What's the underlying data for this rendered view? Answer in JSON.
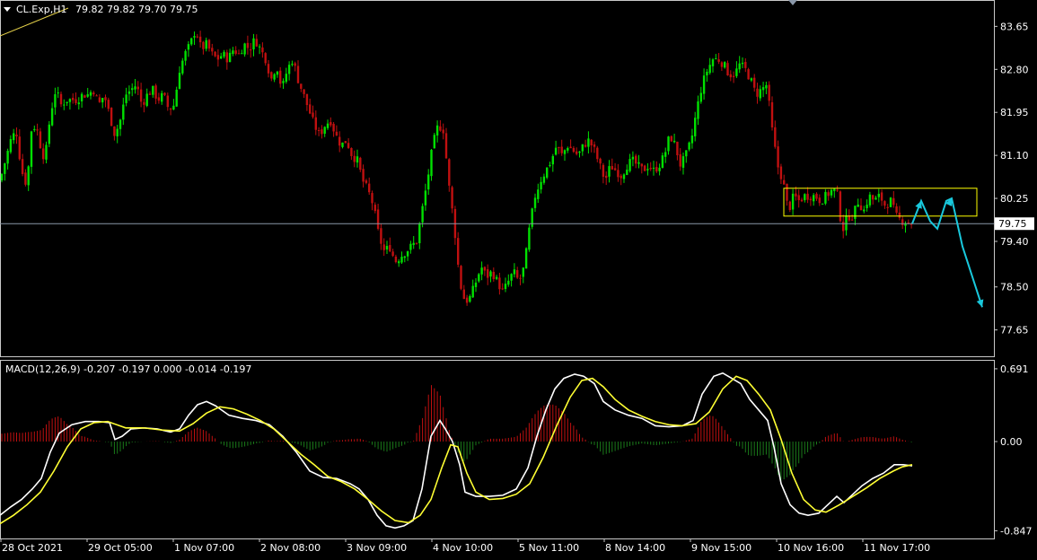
{
  "header": {
    "symbol_text": "CL.Exp,H1",
    "ohlc_text": "79.82 79.82 79.70 79.75"
  },
  "macd_header": "MACD(12,26,9) -0.207 -0.197 0.000 -0.014 -0.197",
  "colors": {
    "background": "#000000",
    "bull": "#00e000",
    "bear": "#c01010",
    "hist_pos": "#c01010",
    "hist_neg": "#1a7a1a",
    "macd_line": "#ffffff",
    "signal_line": "#ffff33",
    "arrow": "#19c8dc",
    "consolidation_box": "#ffff00",
    "price_line": "#8a97a8",
    "frame": "#c8c8c8"
  },
  "chart_data": [
    {
      "type": "candlestick",
      "title": "CL.Exp,H1",
      "ylim": [
        77.2,
        84.1
      ],
      "y_ticks": [
        "83.65",
        "82.80",
        "81.95",
        "81.10",
        "80.25",
        "79.40",
        "78.50",
        "77.65"
      ],
      "current_price": "79.75",
      "x_ticks": [
        "28 Oct 2021",
        "29 Oct 05:00",
        "1 Nov 07:00",
        "2 Nov 08:00",
        "3 Nov 09:00",
        "4 Nov 10:00",
        "5 Nov 11:00",
        "8 Nov 14:00",
        "9 Nov 15:00",
        "10 Nov 16:00",
        "11 Nov 17:00"
      ],
      "close_path": [
        [
          0,
          80.6
        ],
        [
          6,
          81.0
        ],
        [
          12,
          81.4
        ],
        [
          18,
          81.6
        ],
        [
          24,
          80.8
        ],
        [
          30,
          80.5
        ],
        [
          35,
          81.6
        ],
        [
          40,
          81.7
        ],
        [
          45,
          81.3
        ],
        [
          50,
          81.0
        ],
        [
          56,
          81.9
        ],
        [
          62,
          82.4
        ],
        [
          68,
          82.1
        ],
        [
          74,
          82.2
        ],
        [
          80,
          82.2
        ],
        [
          86,
          82.2
        ],
        [
          92,
          82.3
        ],
        [
          98,
          82.3
        ],
        [
          104,
          82.4
        ],
        [
          110,
          82.1
        ],
        [
          116,
          82.3
        ],
        [
          122,
          81.9
        ],
        [
          128,
          81.5
        ],
        [
          134,
          81.8
        ],
        [
          140,
          82.3
        ],
        [
          146,
          82.4
        ],
        [
          152,
          82.5
        ],
        [
          158,
          82.1
        ],
        [
          164,
          82.3
        ],
        [
          170,
          82.4
        ],
        [
          176,
          82.2
        ],
        [
          182,
          82.3
        ],
        [
          188,
          82.0
        ],
        [
          194,
          82.1
        ],
        [
          200,
          82.8
        ],
        [
          206,
          83.1
        ],
        [
          212,
          83.3
        ],
        [
          218,
          83.6
        ],
        [
          224,
          83.2
        ],
        [
          230,
          83.3
        ],
        [
          236,
          83.1
        ],
        [
          242,
          83.0
        ],
        [
          248,
          83.1
        ],
        [
          254,
          83.0
        ],
        [
          260,
          83.2
        ],
        [
          266,
          83.1
        ],
        [
          272,
          83.3
        ],
        [
          278,
          83.2
        ],
        [
          284,
          83.4
        ],
        [
          290,
          83.2
        ],
        [
          296,
          83.0
        ],
        [
          302,
          82.6
        ],
        [
          308,
          82.9
        ],
        [
          314,
          82.4
        ],
        [
          320,
          82.8
        ],
        [
          326,
          83.0
        ],
        [
          332,
          82.6
        ],
        [
          338,
          82.3
        ],
        [
          344,
          82.0
        ],
        [
          350,
          81.7
        ],
        [
          356,
          81.5
        ],
        [
          362,
          81.7
        ],
        [
          368,
          81.8
        ],
        [
          374,
          81.5
        ],
        [
          380,
          81.3
        ],
        [
          386,
          81.4
        ],
        [
          392,
          81.1
        ],
        [
          398,
          81.0
        ],
        [
          404,
          80.6
        ],
        [
          410,
          80.4
        ],
        [
          416,
          80.1
        ],
        [
          422,
          79.5
        ],
        [
          428,
          79.2
        ],
        [
          434,
          79.3
        ],
        [
          440,
          79.0
        ],
        [
          446,
          79.1
        ],
        [
          452,
          79.2
        ],
        [
          458,
          79.3
        ],
        [
          464,
          79.4
        ],
        [
          470,
          80.0
        ],
        [
          476,
          80.6
        ],
        [
          482,
          81.3
        ],
        [
          488,
          81.7
        ],
        [
          494,
          81.6
        ],
        [
          500,
          80.5
        ],
        [
          506,
          79.7
        ],
        [
          512,
          78.6
        ],
        [
          518,
          78.2
        ],
        [
          524,
          78.3
        ],
        [
          530,
          78.6
        ],
        [
          536,
          78.9
        ],
        [
          542,
          78.7
        ],
        [
          548,
          78.8
        ],
        [
          554,
          78.6
        ],
        [
          560,
          78.4
        ],
        [
          566,
          78.6
        ],
        [
          572,
          78.8
        ],
        [
          578,
          78.6
        ],
        [
          584,
          78.9
        ],
        [
          590,
          79.7
        ],
        [
          596,
          80.3
        ],
        [
          602,
          80.6
        ],
        [
          608,
          80.8
        ],
        [
          614,
          81.0
        ],
        [
          620,
          81.3
        ],
        [
          626,
          81.1
        ],
        [
          632,
          81.3
        ],
        [
          638,
          81.2
        ],
        [
          644,
          81.1
        ],
        [
          650,
          81.3
        ],
        [
          656,
          81.4
        ],
        [
          662,
          81.2
        ],
        [
          668,
          80.9
        ],
        [
          674,
          80.6
        ],
        [
          680,
          80.9
        ],
        [
          686,
          80.8
        ],
        [
          692,
          80.7
        ],
        [
          698,
          80.9
        ],
        [
          704,
          81.0
        ],
        [
          710,
          80.9
        ],
        [
          716,
          80.8
        ],
        [
          722,
          80.9
        ],
        [
          728,
          80.8
        ],
        [
          734,
          80.9
        ],
        [
          740,
          81.1
        ],
        [
          746,
          81.5
        ],
        [
          752,
          81.3
        ],
        [
          758,
          80.9
        ],
        [
          764,
          81.1
        ],
        [
          770,
          81.4
        ],
        [
          776,
          82.0
        ],
        [
          782,
          82.5
        ],
        [
          788,
          82.8
        ],
        [
          794,
          83.0
        ],
        [
          800,
          83.0
        ],
        [
          806,
          82.9
        ],
        [
          812,
          82.7
        ],
        [
          818,
          82.7
        ],
        [
          824,
          82.9
        ],
        [
          830,
          82.8
        ],
        [
          836,
          82.6
        ],
        [
          842,
          82.3
        ],
        [
          848,
          82.4
        ],
        [
          854,
          82.5
        ],
        [
          860,
          81.6
        ],
        [
          866,
          80.9
        ],
        [
          872,
          80.6
        ],
        [
          878,
          80.0
        ],
        [
          884,
          80.3
        ],
        [
          890,
          80.2
        ],
        [
          896,
          80.3
        ],
        [
          902,
          80.3
        ],
        [
          908,
          80.3
        ],
        [
          914,
          80.2
        ],
        [
          920,
          80.3
        ],
        [
          926,
          80.4
        ],
        [
          932,
          80.4
        ],
        [
          938,
          79.6
        ],
        [
          944,
          79.9
        ],
        [
          950,
          79.9
        ],
        [
          956,
          80.2
        ],
        [
          962,
          80.0
        ],
        [
          968,
          80.3
        ],
        [
          974,
          80.2
        ],
        [
          980,
          80.3
        ],
        [
          986,
          80.1
        ],
        [
          992,
          80.2
        ],
        [
          998,
          79.9
        ],
        [
          1004,
          79.8
        ],
        [
          1010,
          79.8
        ],
        [
          1016,
          79.75
        ]
      ],
      "consolidation_box": {
        "low": 79.9,
        "high": 80.45
      },
      "projection": [
        [
          1016,
          79.75
        ],
        [
          1026,
          80.2
        ],
        [
          1036,
          79.8
        ],
        [
          1044,
          79.65
        ],
        [
          1054,
          80.2
        ],
        [
          1060,
          80.25
        ],
        [
          1072,
          79.3
        ],
        [
          1094,
          78.1
        ]
      ]
    },
    {
      "type": "macd",
      "title": "MACD(12,26,9)",
      "params": "12,26,9",
      "ylim": [
        -0.92,
        0.75
      ],
      "y_ticks": [
        "0.691",
        "0.00",
        "-0.847"
      ],
      "macd": [
        [
          0,
          -0.7
        ],
        [
          12,
          -0.62
        ],
        [
          24,
          -0.55
        ],
        [
          36,
          -0.45
        ],
        [
          46,
          -0.35
        ],
        [
          56,
          -0.1
        ],
        [
          66,
          0.08
        ],
        [
          80,
          0.16
        ],
        [
          95,
          0.19
        ],
        [
          110,
          0.19
        ],
        [
          122,
          0.18
        ],
        [
          128,
          0.02
        ],
        [
          136,
          0.05
        ],
        [
          146,
          0.12
        ],
        [
          160,
          0.13
        ],
        [
          175,
          0.12
        ],
        [
          190,
          0.09
        ],
        [
          200,
          0.12
        ],
        [
          210,
          0.25
        ],
        [
          220,
          0.35
        ],
        [
          230,
          0.38
        ],
        [
          240,
          0.34
        ],
        [
          255,
          0.25
        ],
        [
          270,
          0.22
        ],
        [
          285,
          0.2
        ],
        [
          300,
          0.16
        ],
        [
          315,
          0.05
        ],
        [
          330,
          -0.1
        ],
        [
          345,
          -0.28
        ],
        [
          360,
          -0.34
        ],
        [
          375,
          -0.35
        ],
        [
          390,
          -0.4
        ],
        [
          400,
          -0.45
        ],
        [
          410,
          -0.55
        ],
        [
          420,
          -0.7
        ],
        [
          430,
          -0.8
        ],
        [
          440,
          -0.82
        ],
        [
          450,
          -0.8
        ],
        [
          460,
          -0.75
        ],
        [
          470,
          -0.45
        ],
        [
          480,
          0.05
        ],
        [
          490,
          0.2
        ],
        [
          496,
          0.12
        ],
        [
          504,
          0.0
        ],
        [
          512,
          -0.22
        ],
        [
          518,
          -0.48
        ],
        [
          530,
          -0.52
        ],
        [
          545,
          -0.52
        ],
        [
          560,
          -0.51
        ],
        [
          575,
          -0.45
        ],
        [
          588,
          -0.25
        ],
        [
          598,
          0.05
        ],
        [
          608,
          0.3
        ],
        [
          618,
          0.5
        ],
        [
          628,
          0.6
        ],
        [
          640,
          0.64
        ],
        [
          650,
          0.62
        ],
        [
          662,
          0.55
        ],
        [
          672,
          0.38
        ],
        [
          685,
          0.3
        ],
        [
          700,
          0.25
        ],
        [
          715,
          0.22
        ],
        [
          730,
          0.15
        ],
        [
          745,
          0.14
        ],
        [
          760,
          0.15
        ],
        [
          772,
          0.2
        ],
        [
          782,
          0.45
        ],
        [
          795,
          0.62
        ],
        [
          805,
          0.65
        ],
        [
          815,
          0.6
        ],
        [
          825,
          0.55
        ],
        [
          835,
          0.4
        ],
        [
          845,
          0.3
        ],
        [
          855,
          0.2
        ],
        [
          862,
          -0.05
        ],
        [
          870,
          -0.4
        ],
        [
          880,
          -0.6
        ],
        [
          890,
          -0.68
        ],
        [
          900,
          -0.7
        ],
        [
          912,
          -0.68
        ],
        [
          922,
          -0.6
        ],
        [
          932,
          -0.52
        ],
        [
          940,
          -0.58
        ],
        [
          950,
          -0.5
        ],
        [
          960,
          -0.42
        ],
        [
          972,
          -0.35
        ],
        [
          984,
          -0.3
        ],
        [
          996,
          -0.22
        ],
        [
          1006,
          -0.22
        ],
        [
          1016,
          -0.23
        ]
      ],
      "signal": [
        [
          0,
          -0.78
        ],
        [
          15,
          -0.7
        ],
        [
          30,
          -0.6
        ],
        [
          45,
          -0.48
        ],
        [
          60,
          -0.28
        ],
        [
          75,
          -0.05
        ],
        [
          90,
          0.12
        ],
        [
          105,
          0.18
        ],
        [
          120,
          0.19
        ],
        [
          140,
          0.13
        ],
        [
          160,
          0.13
        ],
        [
          180,
          0.11
        ],
        [
          200,
          0.1
        ],
        [
          215,
          0.17
        ],
        [
          230,
          0.27
        ],
        [
          245,
          0.33
        ],
        [
          260,
          0.31
        ],
        [
          275,
          0.26
        ],
        [
          290,
          0.2
        ],
        [
          305,
          0.12
        ],
        [
          320,
          0.0
        ],
        [
          335,
          -0.12
        ],
        [
          350,
          -0.22
        ],
        [
          365,
          -0.33
        ],
        [
          380,
          -0.38
        ],
        [
          395,
          -0.45
        ],
        [
          410,
          -0.55
        ],
        [
          425,
          -0.66
        ],
        [
          440,
          -0.75
        ],
        [
          455,
          -0.77
        ],
        [
          468,
          -0.7
        ],
        [
          480,
          -0.55
        ],
        [
          492,
          -0.25
        ],
        [
          502,
          -0.03
        ],
        [
          510,
          -0.05
        ],
        [
          520,
          -0.3
        ],
        [
          530,
          -0.48
        ],
        [
          545,
          -0.55
        ],
        [
          560,
          -0.54
        ],
        [
          575,
          -0.5
        ],
        [
          590,
          -0.4
        ],
        [
          605,
          -0.15
        ],
        [
          620,
          0.15
        ],
        [
          635,
          0.42
        ],
        [
          648,
          0.58
        ],
        [
          660,
          0.6
        ],
        [
          672,
          0.52
        ],
        [
          685,
          0.4
        ],
        [
          700,
          0.3
        ],
        [
          715,
          0.24
        ],
        [
          730,
          0.19
        ],
        [
          745,
          0.16
        ],
        [
          760,
          0.15
        ],
        [
          775,
          0.17
        ],
        [
          790,
          0.28
        ],
        [
          805,
          0.5
        ],
        [
          820,
          0.62
        ],
        [
          832,
          0.58
        ],
        [
          845,
          0.45
        ],
        [
          858,
          0.3
        ],
        [
          870,
          0.02
        ],
        [
          882,
          -0.3
        ],
        [
          895,
          -0.55
        ],
        [
          908,
          -0.65
        ],
        [
          920,
          -0.67
        ],
        [
          935,
          -0.6
        ],
        [
          950,
          -0.52
        ],
        [
          965,
          -0.44
        ],
        [
          980,
          -0.35
        ],
        [
          995,
          -0.28
        ],
        [
          1005,
          -0.24
        ],
        [
          1016,
          -0.22
        ]
      ]
    }
  ]
}
